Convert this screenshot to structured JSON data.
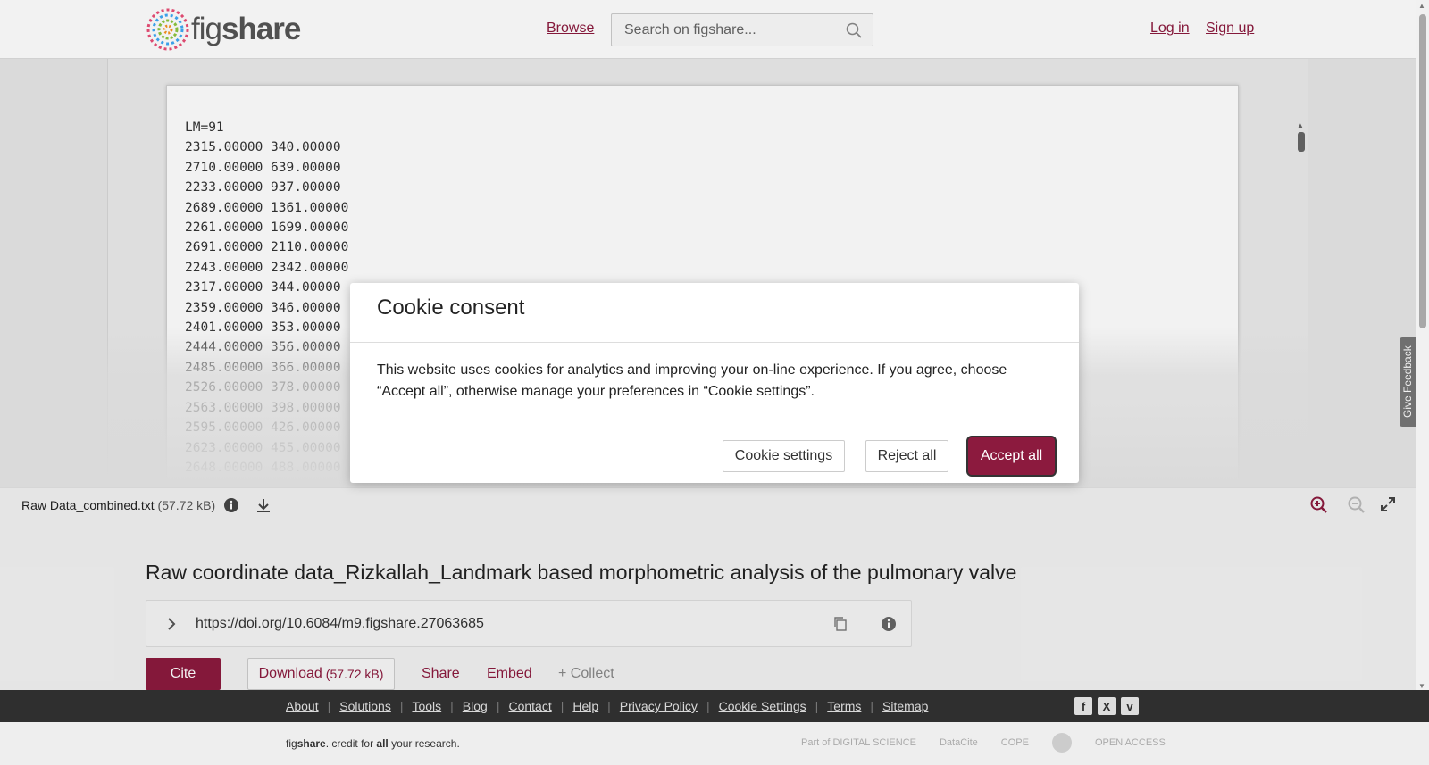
{
  "header": {
    "logo_text_a": "fig",
    "logo_text_b": "share",
    "browse": "Browse",
    "search_placeholder": "Search on figshare...",
    "login": "Log in",
    "signup": "Sign up"
  },
  "viewer": {
    "lines": [
      "LM=91",
      "2315.00000 340.00000",
      "2710.00000 639.00000",
      "2233.00000 937.00000",
      "2689.00000 1361.00000",
      "2261.00000 1699.00000",
      "2691.00000 2110.00000",
      "2243.00000 2342.00000",
      "2317.00000 344.00000",
      "2359.00000 346.00000",
      "2401.00000 353.00000",
      "2444.00000 356.00000",
      "2485.00000 366.00000",
      "2526.00000 378.00000",
      "2563.00000 398.00000",
      "2595.00000 426.00000",
      "2623.00000 455.00000",
      "2648.00000 488.00000"
    ],
    "feedback": "Give Feedback"
  },
  "filebar": {
    "filename": "Raw Data_combined.txt",
    "filesize": "(57.72 kB)"
  },
  "item": {
    "title": "Raw coordinate data_Rizkallah_Landmark based morphometric analysis of the pulmonary valve",
    "doi": "https://doi.org/10.6084/m9.figshare.27063685",
    "cite": "Cite",
    "download": "Download",
    "download_size": "(57.72 kB)",
    "share": "Share",
    "embed": "Embed",
    "collect": "+ Collect"
  },
  "footer": {
    "links": [
      "About",
      "Solutions",
      "Tools",
      "Blog",
      "Contact",
      "Help",
      "Privacy Policy",
      "Cookie Settings",
      "Terms",
      "Sitemap"
    ],
    "tag_a": "fig",
    "tag_b": "share",
    "tag_c": ". credit for ",
    "tag_d": "all",
    "tag_e": " your research.",
    "partner_1": "Part of DIGITAL SCIENCE",
    "partner_2": "DataCite",
    "partner_3": "COPE",
    "partner_5": "OPEN ACCESS"
  },
  "cookie": {
    "title": "Cookie consent",
    "body": "This website uses cookies for analytics and improving your on-line experience. If you agree, choose “Accept all”, otherwise manage your preferences in “Cookie settings”.",
    "settings": "Cookie settings",
    "reject": "Reject all",
    "accept": "Accept all"
  },
  "colors": {
    "brand": "#8c1a3e",
    "footer_bg": "#2f2f2f"
  }
}
